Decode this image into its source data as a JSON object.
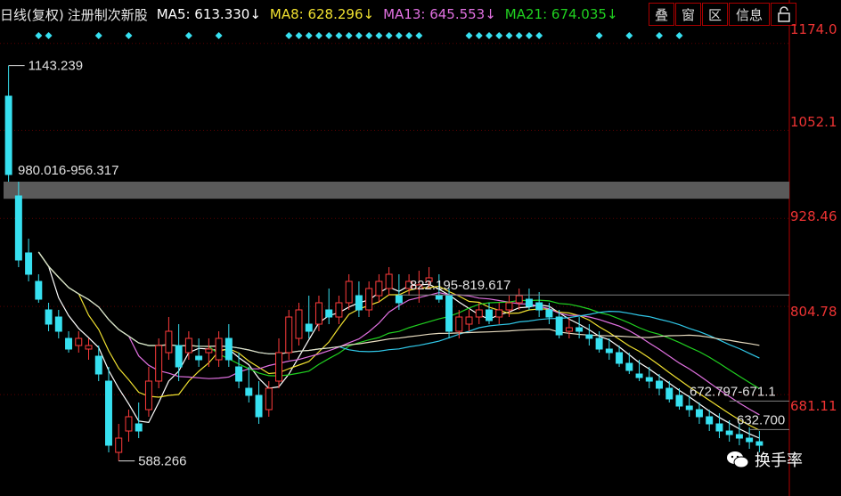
{
  "header": {
    "title": "日线(复权)",
    "subtitle": "注册制次新股",
    "ma": [
      {
        "label": "MA5: 613.330↓",
        "color": "#ffffff"
      },
      {
        "label": "MA8: 628.296↓",
        "color": "#f0e030"
      },
      {
        "label": "MA13: 645.553↓",
        "color": "#e070e0"
      },
      {
        "label": "MA21: 674.035↓",
        "color": "#20d020"
      }
    ]
  },
  "buttons": [
    "叠",
    "窗",
    "区",
    "信息"
  ],
  "lock_icon": "lock-icon",
  "y_axis": [
    "1174.0",
    "1052.1",
    "928.46",
    "804.78",
    "681.11"
  ],
  "annotations": {
    "high": "1143.239",
    "low": "588.266",
    "gap1": "980.016-956.317",
    "gap2": "822.195-819.617",
    "gap3": "672.797-671.1",
    "gap4": "632.700"
  },
  "watermark": "换手率",
  "colors": {
    "up": "#ff3b3b",
    "down": "#37e0f0",
    "ma5": "#ffffff",
    "ma8": "#f0e030",
    "ma13": "#e070e0",
    "ma21": "#20d020",
    "ma_long": "#30c8e8",
    "ma_slow": "#e8dcc0"
  },
  "chart_data": {
    "type": "candlestick",
    "ylim": [
      560,
      1190
    ],
    "candles": [
      [
        1100,
        1143,
        980,
        990
      ],
      [
        960,
        980,
        860,
        870
      ],
      [
        880,
        900,
        840,
        850
      ],
      [
        840,
        850,
        810,
        815
      ],
      [
        800,
        810,
        770,
        780
      ],
      [
        790,
        800,
        760,
        770
      ],
      [
        760,
        770,
        740,
        745
      ],
      [
        750,
        770,
        740,
        760
      ],
      [
        745,
        760,
        730,
        750
      ],
      [
        735,
        750,
        700,
        710
      ],
      [
        700,
        720,
        600,
        610
      ],
      [
        600,
        640,
        588,
        620
      ],
      [
        630,
        660,
        615,
        650
      ],
      [
        640,
        670,
        620,
        630
      ],
      [
        660,
        720,
        650,
        700
      ],
      [
        700,
        760,
        690,
        750
      ],
      [
        740,
        790,
        730,
        770
      ],
      [
        750,
        780,
        700,
        720
      ],
      [
        740,
        770,
        730,
        760
      ],
      [
        735,
        760,
        720,
        730
      ],
      [
        740,
        760,
        720,
        745
      ],
      [
        730,
        770,
        720,
        760
      ],
      [
        760,
        780,
        720,
        730
      ],
      [
        720,
        740,
        690,
        700
      ],
      [
        690,
        720,
        670,
        680
      ],
      [
        680,
        700,
        640,
        650
      ],
      [
        660,
        700,
        650,
        690
      ],
      [
        700,
        760,
        690,
        740
      ],
      [
        740,
        800,
        730,
        790
      ],
      [
        760,
        810,
        750,
        800
      ],
      [
        780,
        820,
        760,
        770
      ],
      [
        780,
        820,
        770,
        810
      ],
      [
        800,
        830,
        780,
        790
      ],
      [
        790,
        820,
        780,
        810
      ],
      [
        810,
        850,
        800,
        840
      ],
      [
        820,
        840,
        790,
        800
      ],
      [
        800,
        840,
        790,
        830
      ],
      [
        820,
        850,
        810,
        840
      ],
      [
        830,
        860,
        820,
        850
      ],
      [
        820,
        850,
        800,
        810
      ],
      [
        830,
        850,
        820,
        840
      ],
      [
        830,
        855,
        810,
        835
      ],
      [
        840,
        860,
        830,
        845
      ],
      [
        820,
        850,
        810,
        815
      ],
      [
        820,
        830,
        760,
        770
      ],
      [
        770,
        800,
        760,
        790
      ],
      [
        780,
        800,
        770,
        790
      ],
      [
        790,
        810,
        780,
        800
      ],
      [
        800,
        810,
        780,
        785
      ],
      [
        790,
        810,
        780,
        800
      ],
      [
        800,
        820,
        790,
        810
      ],
      [
        810,
        830,
        800,
        820
      ],
      [
        815,
        830,
        800,
        805
      ],
      [
        810,
        825,
        790,
        800
      ],
      [
        800,
        810,
        780,
        790
      ],
      [
        790,
        800,
        760,
        765
      ],
      [
        770,
        790,
        760,
        775
      ],
      [
        775,
        790,
        760,
        770
      ],
      [
        765,
        780,
        750,
        760
      ],
      [
        760,
        770,
        740,
        745
      ],
      [
        745,
        760,
        730,
        740
      ],
      [
        740,
        750,
        720,
        725
      ],
      [
        725,
        740,
        710,
        715
      ],
      [
        710,
        730,
        700,
        705
      ],
      [
        705,
        720,
        690,
        700
      ],
      [
        700,
        710,
        680,
        690
      ],
      [
        690,
        700,
        670,
        675
      ],
      [
        680,
        690,
        660,
        665
      ],
      [
        665,
        680,
        650,
        660
      ],
      [
        660,
        670,
        640,
        650
      ],
      [
        650,
        660,
        630,
        640
      ],
      [
        640,
        655,
        620,
        630
      ],
      [
        630,
        645,
        615,
        625
      ],
      [
        625,
        640,
        610,
        620
      ],
      [
        620,
        635,
        605,
        615
      ],
      [
        615,
        630,
        600,
        610
      ]
    ]
  }
}
